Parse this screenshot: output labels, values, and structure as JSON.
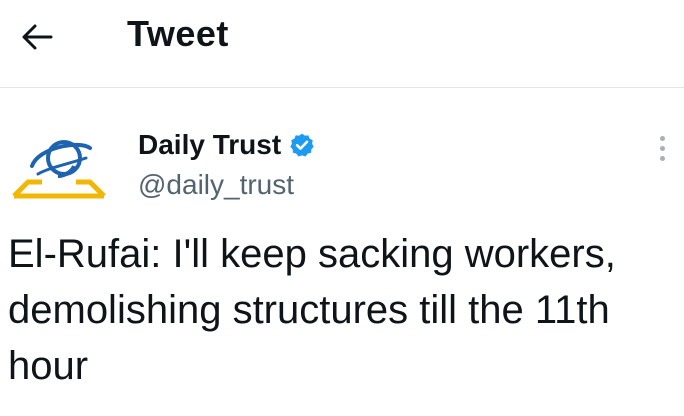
{
  "header": {
    "title": "Tweet",
    "back_icon": "arrow-left-icon"
  },
  "tweet": {
    "author": {
      "display_name": "Daily Trust",
      "handle": "@daily_trust",
      "verified": true,
      "verified_color": "#1d9bf0",
      "avatar_icon": "daily-trust-logo"
    },
    "more_icon": "more-vertical-icon",
    "text": "El-Rufai: I'll keep sacking workers, demolishing structures till the 11th hour"
  },
  "colors": {
    "text": "#0f1419",
    "secondary_text": "#536471",
    "divider": "#e6e6e6",
    "logo_blue": "#1e63b0",
    "logo_yellow": "#f2b705"
  }
}
